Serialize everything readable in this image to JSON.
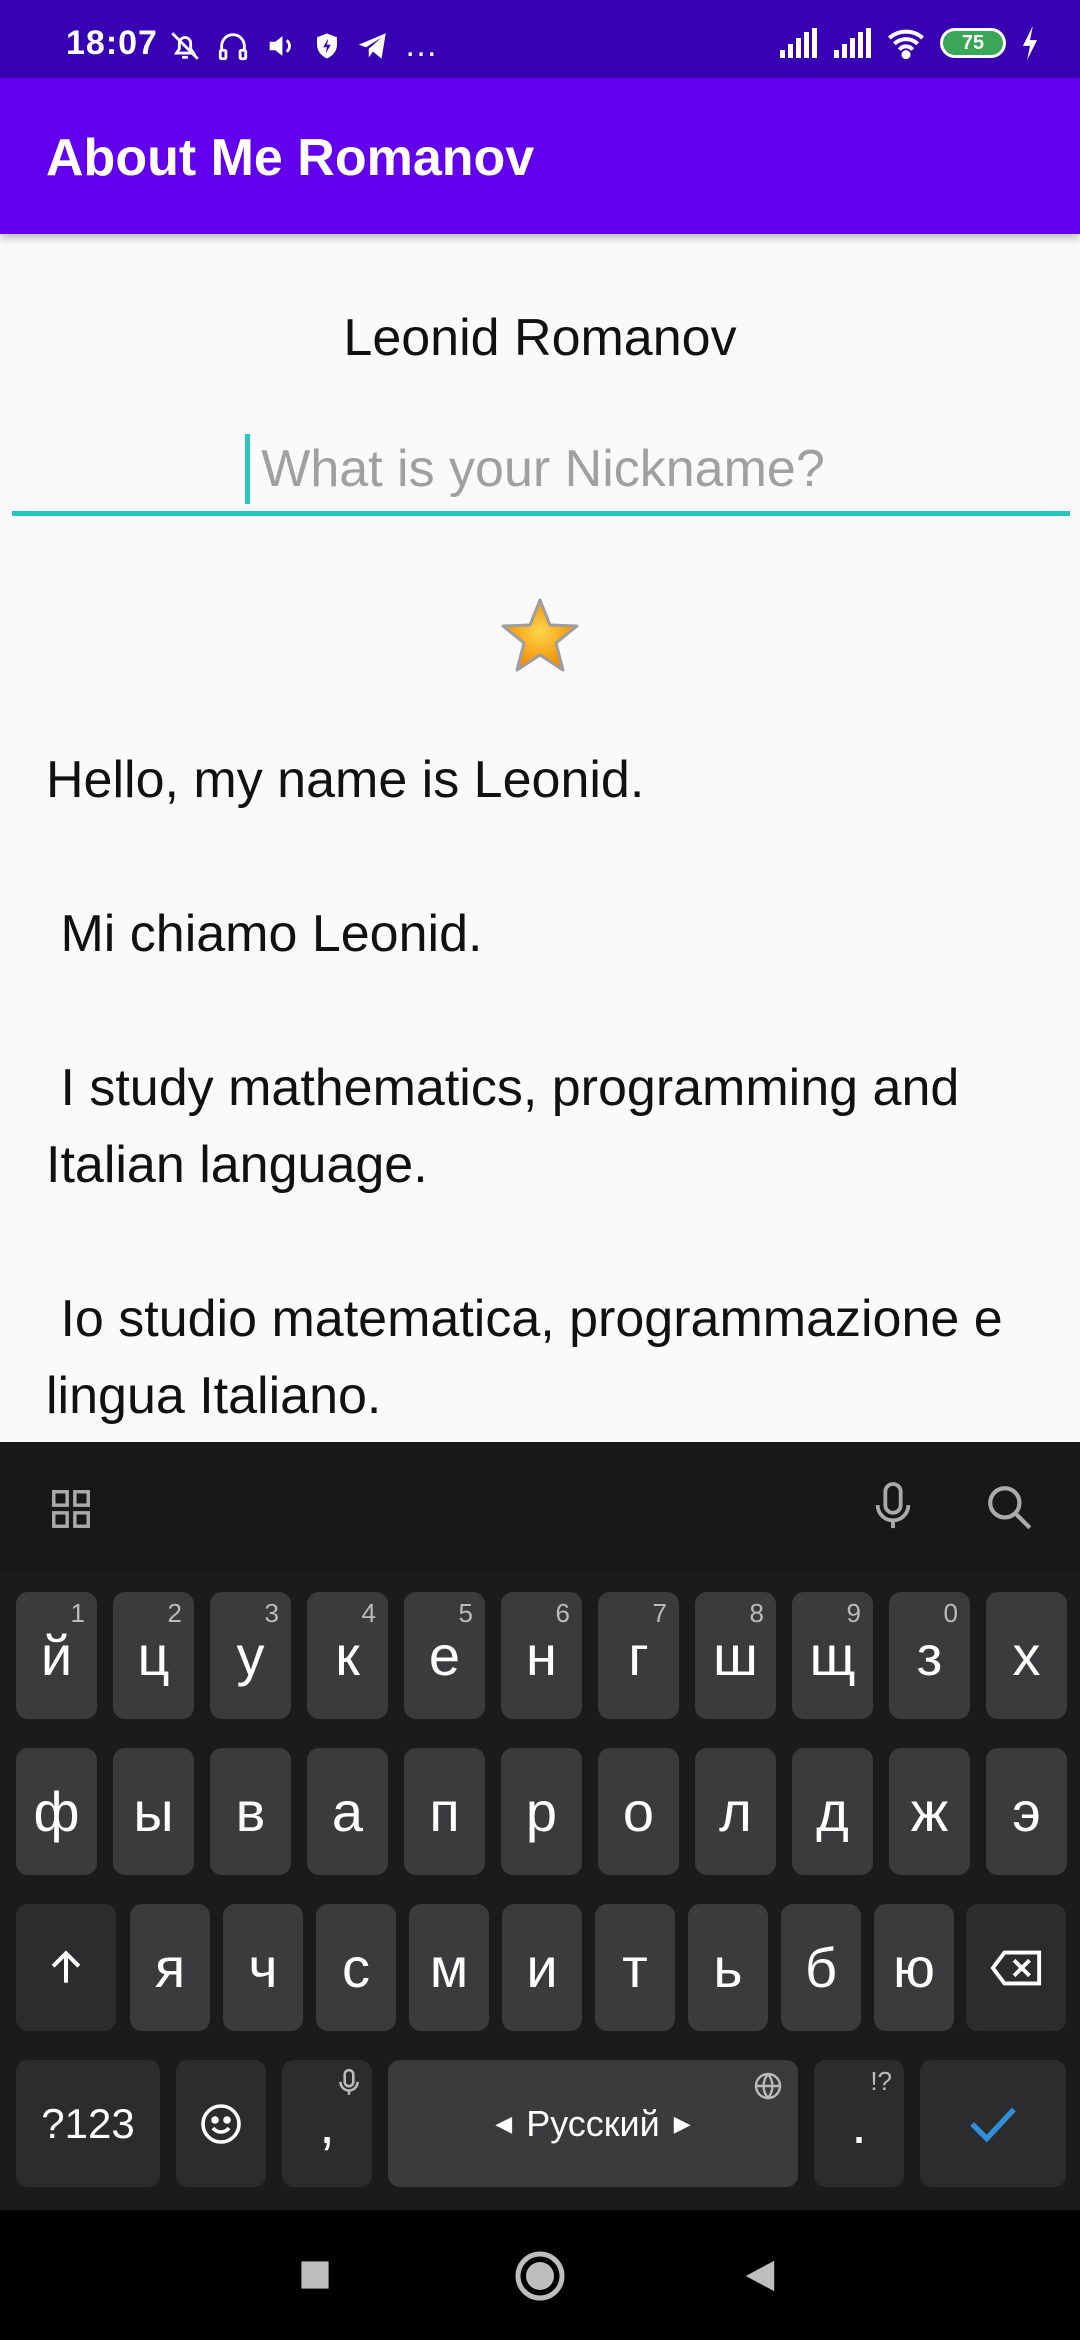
{
  "status_bar": {
    "time": "18:07",
    "battery": "75",
    "more": "…"
  },
  "app_bar": {
    "title": "About Me Romanov"
  },
  "main": {
    "name": "Leonid Romanov",
    "nickname": {
      "placeholder": "What is your Nickname?",
      "value": ""
    },
    "bio": "Hello, my name is Leonid.\n\n Mi chiamo Leonid.\n\n I study mathematics, programming and Italian language.\n\n Io studio matematica, programmazione e lingua Italiano."
  },
  "keyboard": {
    "row1": [
      {
        "label": "й",
        "hint": "1"
      },
      {
        "label": "ц",
        "hint": "2"
      },
      {
        "label": "у",
        "hint": "3"
      },
      {
        "label": "к",
        "hint": "4"
      },
      {
        "label": "е",
        "hint": "5"
      },
      {
        "label": "н",
        "hint": "6"
      },
      {
        "label": "г",
        "hint": "7"
      },
      {
        "label": "ш",
        "hint": "8"
      },
      {
        "label": "щ",
        "hint": "9"
      },
      {
        "label": "з",
        "hint": "0"
      },
      {
        "label": "х",
        "hint": ""
      }
    ],
    "row2": [
      "ф",
      "ы",
      "в",
      "а",
      "п",
      "р",
      "о",
      "л",
      "д",
      "ж",
      "э"
    ],
    "row3": [
      "я",
      "ч",
      "с",
      "м",
      "и",
      "т",
      "ь",
      "б",
      "ю"
    ],
    "symbols_label": "?123",
    "comma_label": ",",
    "space_label": "Русский",
    "period_label": ".",
    "period_hint": "!?"
  },
  "colors": {
    "status_bar": "#3700b3",
    "app_bar": "#6200ee",
    "accent": "#26c6bd",
    "keyboard_bg": "#1b1b1d",
    "enter_check": "#2f8fd8"
  }
}
